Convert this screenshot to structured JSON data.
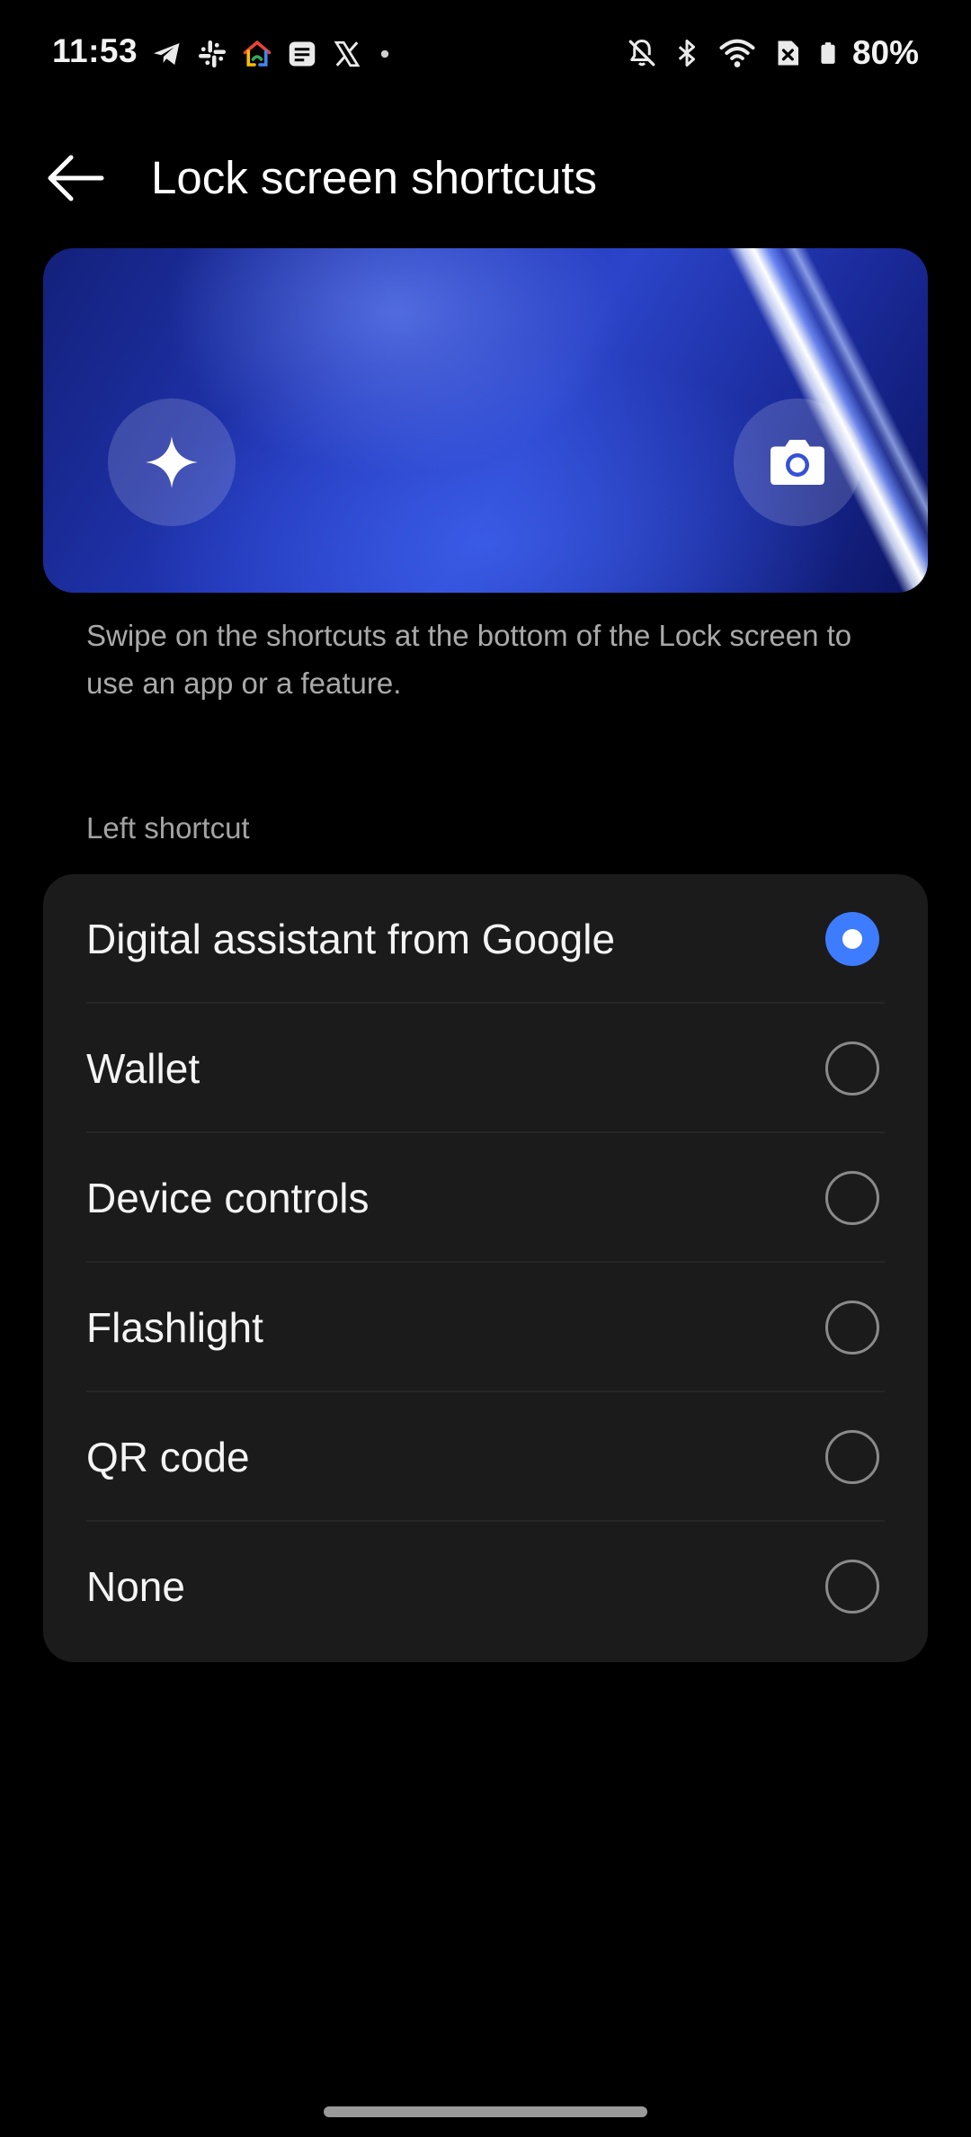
{
  "status_bar": {
    "time": "11:53",
    "left_icons": [
      "telegram-icon",
      "slack-icon",
      "google-home-icon",
      "messages-icon",
      "x-icon",
      "dot-icon"
    ],
    "right_icons": [
      "bell-off-icon",
      "bluetooth-icon",
      "wifi-icon",
      "sim-off-icon",
      "battery-icon"
    ],
    "battery_percent": "80%"
  },
  "header": {
    "title": "Lock screen shortcuts"
  },
  "preview": {
    "left_shortcut_icon": "sparkle-icon",
    "right_shortcut_icon": "camera-icon"
  },
  "description": "Swipe on the shortcuts at the bottom of the Lock screen to use an app or a feature.",
  "section_label": "Left shortcut",
  "options": [
    {
      "label": "Digital assistant from Google",
      "selected": true
    },
    {
      "label": "Wallet",
      "selected": false
    },
    {
      "label": "Device controls",
      "selected": false
    },
    {
      "label": "Flashlight",
      "selected": false
    },
    {
      "label": "QR code",
      "selected": false
    },
    {
      "label": "None",
      "selected": false
    }
  ],
  "colors": {
    "accent": "#3d7cff",
    "background": "#000000",
    "card": "#1b1b1b"
  }
}
